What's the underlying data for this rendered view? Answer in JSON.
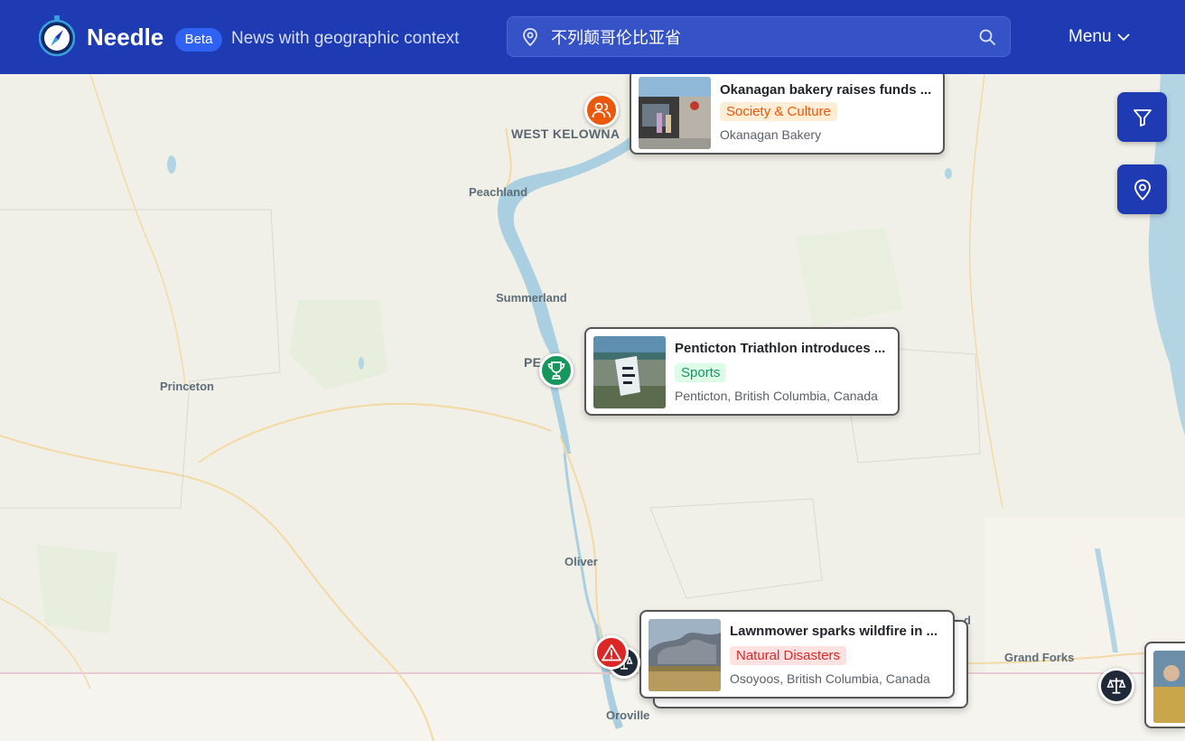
{
  "header": {
    "brand": "Needle",
    "badge": "Beta",
    "tagline": "News with geographic context",
    "search_value": "不列颠哥伦比亚省",
    "menu_label": "Menu"
  },
  "map": {
    "places": [
      "WEST KELOWNA",
      "Peachland",
      "Summerland",
      "PENTICTON",
      "Princeton",
      "Oliver",
      "Osoyoos",
      "Oroville",
      "Grand Forks",
      "Rock Creek"
    ],
    "places_display": {
      "west_kelowna": "WEST KELOWNA",
      "peachland": "Peachland",
      "summerland": "Summerland",
      "penticton_partial": "PE",
      "penticton_partial2": "CTO",
      "princeton": "Princeton",
      "oliver": "Oliver",
      "oroville": "Oroville",
      "grand_forks": "Grand Forks",
      "osoyoos_partial": "O",
      "rock_creek_partial": "d"
    }
  },
  "stories": [
    {
      "title": "Okanagan bakery raises funds ...",
      "category": "Society & Culture",
      "location": "Okanagan Bakery",
      "icon": "people-icon",
      "color": "#ea580c",
      "tag_bg": "#ffedd5",
      "tag_fg": "#ea580c"
    },
    {
      "title": "Penticton Triathlon introduces ...",
      "category": "Sports",
      "location": "Penticton, British Columbia, Canada",
      "icon": "trophy-icon",
      "color": "#16955d",
      "tag_bg": "#dcfce7",
      "tag_fg": "#16955d"
    },
    {
      "title": "Lawnmower sparks wildfire in ...",
      "category": "Natural Disasters",
      "location": "Osoyoos, British Columbia, Canada",
      "icon": "warning-icon",
      "color": "#dc2626",
      "tag_bg": "#fee2e2",
      "tag_fg": "#dc2626"
    }
  ],
  "controls": {
    "filter_icon": "filter-icon",
    "locate_icon": "map-pin-icon",
    "law_icon": "scales-icon"
  },
  "colors": {
    "header": "#1e3bb3",
    "water": "#a9cfe0",
    "land": "#f1f0e8",
    "border": "#e8c9d4"
  }
}
